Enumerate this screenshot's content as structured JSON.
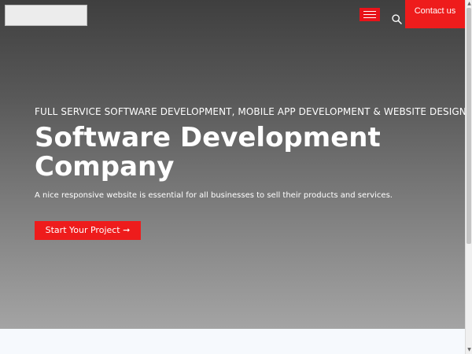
{
  "header": {
    "menu_icon": "hamburger-menu-icon",
    "search_icon": "search-icon",
    "contact_label": "Contact us"
  },
  "hero": {
    "subtitle": "FULL SERVICE SOFTWARE DEVELOPMENT, MOBILE APP DEVELOPMENT & WEBSITE DESIGNING",
    "title": "Software Development Company",
    "lead": "A nice responsive website is essential for all businesses to sell their products and services.",
    "cta_label": "Start Your Project ➞"
  },
  "colors": {
    "accent": "#ee1c1c",
    "hero_top": "#3f3f3f",
    "hero_bottom": "#a4a4a4",
    "page_background": "#f6f9fd"
  }
}
